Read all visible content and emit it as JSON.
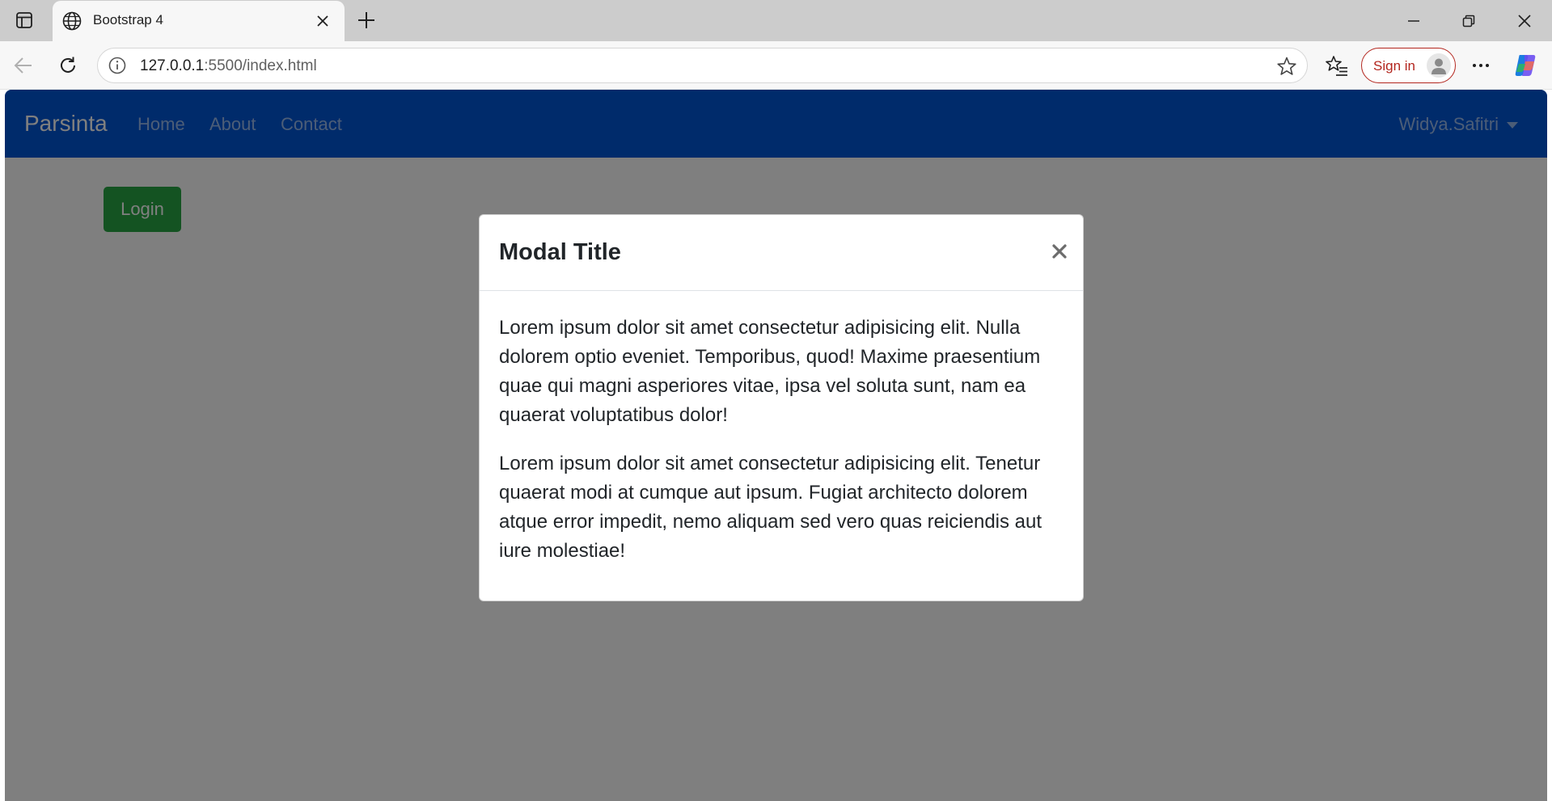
{
  "browser": {
    "tab_title": "Bootstrap 4",
    "url_host": "127.0.0.1",
    "url_rest": ":5500/index.html",
    "signin_label": "Sign in"
  },
  "navbar": {
    "brand": "Parsinta",
    "links": [
      "Home",
      "About",
      "Contact"
    ],
    "user": "Widya.Safitri",
    "color": "#0056d6"
  },
  "page": {
    "login_label": "Login"
  },
  "modal": {
    "title": "Modal Title",
    "close_glyph": "×",
    "paragraphs": [
      "Lorem ipsum dolor sit amet consectetur adipisicing elit. Nulla dolorem optio eveniet. Temporibus, quod! Maxime praesentium quae qui magni asperiores vitae, ipsa vel soluta sunt, nam ea quaerat voluptatibus dolor!",
      "Lorem ipsum dolor sit amet consectetur adipisicing elit. Tenetur quaerat modi at cumque aut ipsum. Fugiat architecto dolorem atque error impedit, nemo aliquam sed vero quas reiciendis aut iure molestiae!"
    ]
  },
  "icons": {
    "tab_actions": "tab-actions-icon",
    "globe": "globe-icon",
    "close": "close-icon",
    "new_tab": "plus-icon",
    "back": "back-arrow-icon",
    "refresh": "refresh-icon",
    "info": "info-icon",
    "favorite": "star-icon",
    "favorites": "favorites-icon",
    "more": "more-icon",
    "copilot": "copilot-icon"
  }
}
